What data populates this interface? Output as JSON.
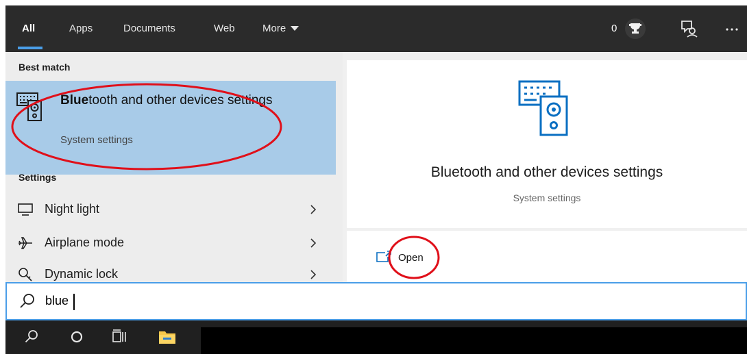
{
  "tabs": [
    {
      "label": "All"
    },
    {
      "label": "Apps"
    },
    {
      "label": "Documents"
    },
    {
      "label": "Web"
    },
    {
      "label": "More"
    }
  ],
  "topbar": {
    "points": "0",
    "icons": [
      "trophy-icon",
      "feedback-icon",
      "more-options-icon"
    ]
  },
  "best_match": {
    "header": "Best match",
    "title_bold": "Blue",
    "title_rest": "tooth and other devices settings",
    "subtitle": "System settings"
  },
  "settings": {
    "header": "Settings",
    "items": [
      {
        "label": "Night light",
        "icon": "monitor-icon"
      },
      {
        "label": "Airplane mode",
        "icon": "airplane-icon"
      },
      {
        "label": "Dynamic lock",
        "icon": "key-icon"
      }
    ]
  },
  "preview": {
    "title": "Bluetooth and other devices settings",
    "subtitle": "System settings",
    "open_label": "Open"
  },
  "search": {
    "value": "blue"
  },
  "taskbar": {
    "icons": [
      "search-icon",
      "cortana-icon",
      "task-view-icon",
      "file-explorer-icon"
    ]
  },
  "colors": {
    "accent": "#4a9ee8",
    "selection": "#a8cbe8",
    "annotation": "#e0101a"
  }
}
